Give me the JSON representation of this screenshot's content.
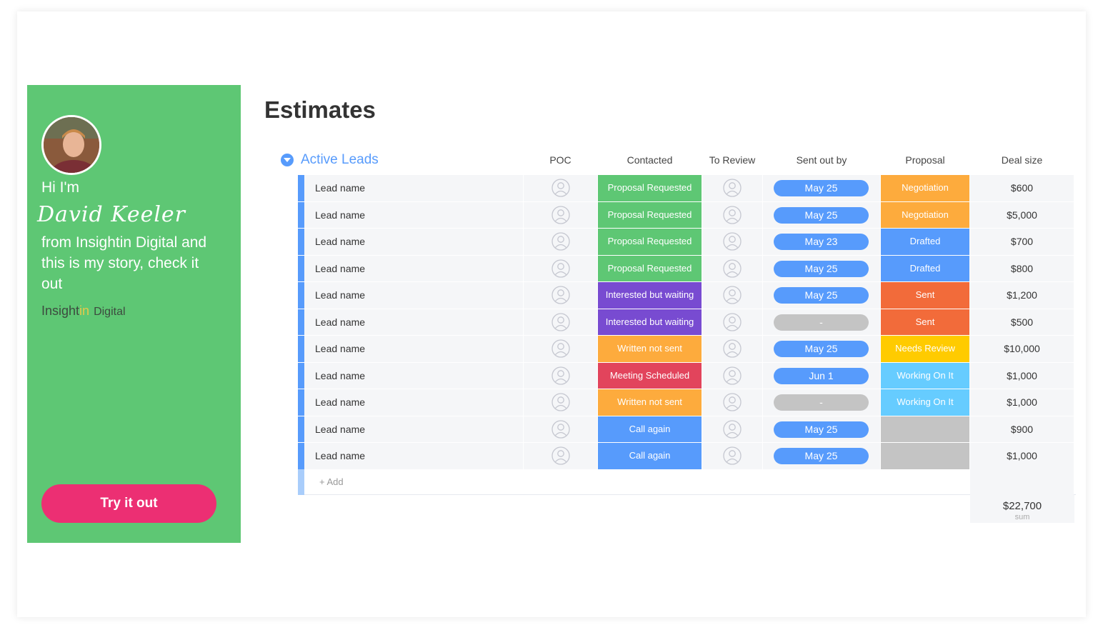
{
  "profile": {
    "greeting": "Hi I'm",
    "name": "David Keeler",
    "story": "from Insightin Digital and this is my story, check it out",
    "brand_part1": "Insight",
    "brand_part2": "in",
    "brand_part3": "Digital",
    "cta_label": "Try it out"
  },
  "board": {
    "title": "Estimates",
    "group_name": "Active Leads",
    "columns": [
      "POC",
      "Contacted",
      "To Review",
      "Sent out by",
      "Proposal",
      "Deal size"
    ],
    "add_label": "+ Add",
    "sum_value": "$22,700",
    "sum_label": "sum"
  },
  "colors": {
    "panel": "#5ec774",
    "cta": "#ec2f73",
    "accent": "#579bfc",
    "proposal_requested": "#5ec774",
    "interested_waiting": "#784bd1",
    "written_not_sent": "#fdab3d",
    "meeting_scheduled": "#e2445c",
    "call_again": "#579bfc",
    "negotiation": "#fdab3d",
    "drafted": "#579bfc",
    "sent": "#f26b3a",
    "needs_review": "#ffcb00",
    "working_on_it": "#66ccff",
    "empty": "#c4c4c4"
  },
  "rows": [
    {
      "name": "Lead name",
      "contacted": "Proposal Requested",
      "contacted_color": "#5ec774",
      "sent_out_by": "May 25",
      "sent_color": "#579bfc",
      "proposal": "Negotiation",
      "proposal_color": "#fdab3d",
      "deal": "$600"
    },
    {
      "name": "Lead name",
      "contacted": "Proposal Requested",
      "contacted_color": "#5ec774",
      "sent_out_by": "May 25",
      "sent_color": "#579bfc",
      "proposal": "Negotiation",
      "proposal_color": "#fdab3d",
      "deal": "$5,000"
    },
    {
      "name": "Lead name",
      "contacted": "Proposal Requested",
      "contacted_color": "#5ec774",
      "sent_out_by": "May 23",
      "sent_color": "#579bfc",
      "proposal": "Drafted",
      "proposal_color": "#579bfc",
      "deal": "$700"
    },
    {
      "name": "Lead name",
      "contacted": "Proposal Requested",
      "contacted_color": "#5ec774",
      "sent_out_by": "May 25",
      "sent_color": "#579bfc",
      "proposal": "Drafted",
      "proposal_color": "#579bfc",
      "deal": "$800"
    },
    {
      "name": "Lead name",
      "contacted": "Interested but waiting",
      "contacted_color": "#784bd1",
      "sent_out_by": "May 25",
      "sent_color": "#579bfc",
      "proposal": "Sent",
      "proposal_color": "#f26b3a",
      "deal": "$1,200"
    },
    {
      "name": "Lead name",
      "contacted": "Interested but waiting",
      "contacted_color": "#784bd1",
      "sent_out_by": "-",
      "sent_color": "#c4c4c4",
      "proposal": "Sent",
      "proposal_color": "#f26b3a",
      "deal": "$500"
    },
    {
      "name": "Lead name",
      "contacted": "Written not sent",
      "contacted_color": "#fdab3d",
      "sent_out_by": "May 25",
      "sent_color": "#579bfc",
      "proposal": "Needs Review",
      "proposal_color": "#ffcb00",
      "deal": "$10,000"
    },
    {
      "name": "Lead name",
      "contacted": "Meeting Scheduled",
      "contacted_color": "#e2445c",
      "sent_out_by": "Jun 1",
      "sent_color": "#579bfc",
      "proposal": "Working On It",
      "proposal_color": "#66ccff",
      "deal": "$1,000"
    },
    {
      "name": "Lead name",
      "contacted": "Written not sent",
      "contacted_color": "#fdab3d",
      "sent_out_by": "-",
      "sent_color": "#c4c4c4",
      "proposal": "Working On It",
      "proposal_color": "#66ccff",
      "deal": "$1,000"
    },
    {
      "name": "Lead name",
      "contacted": "Call again",
      "contacted_color": "#579bfc",
      "sent_out_by": "May 25",
      "sent_color": "#579bfc",
      "proposal": "",
      "proposal_color": "#c4c4c4",
      "deal": "$900"
    },
    {
      "name": "Lead name",
      "contacted": "Call again",
      "contacted_color": "#579bfc",
      "sent_out_by": "May 25",
      "sent_color": "#579bfc",
      "proposal": "",
      "proposal_color": "#c4c4c4",
      "deal": "$1,000"
    }
  ]
}
